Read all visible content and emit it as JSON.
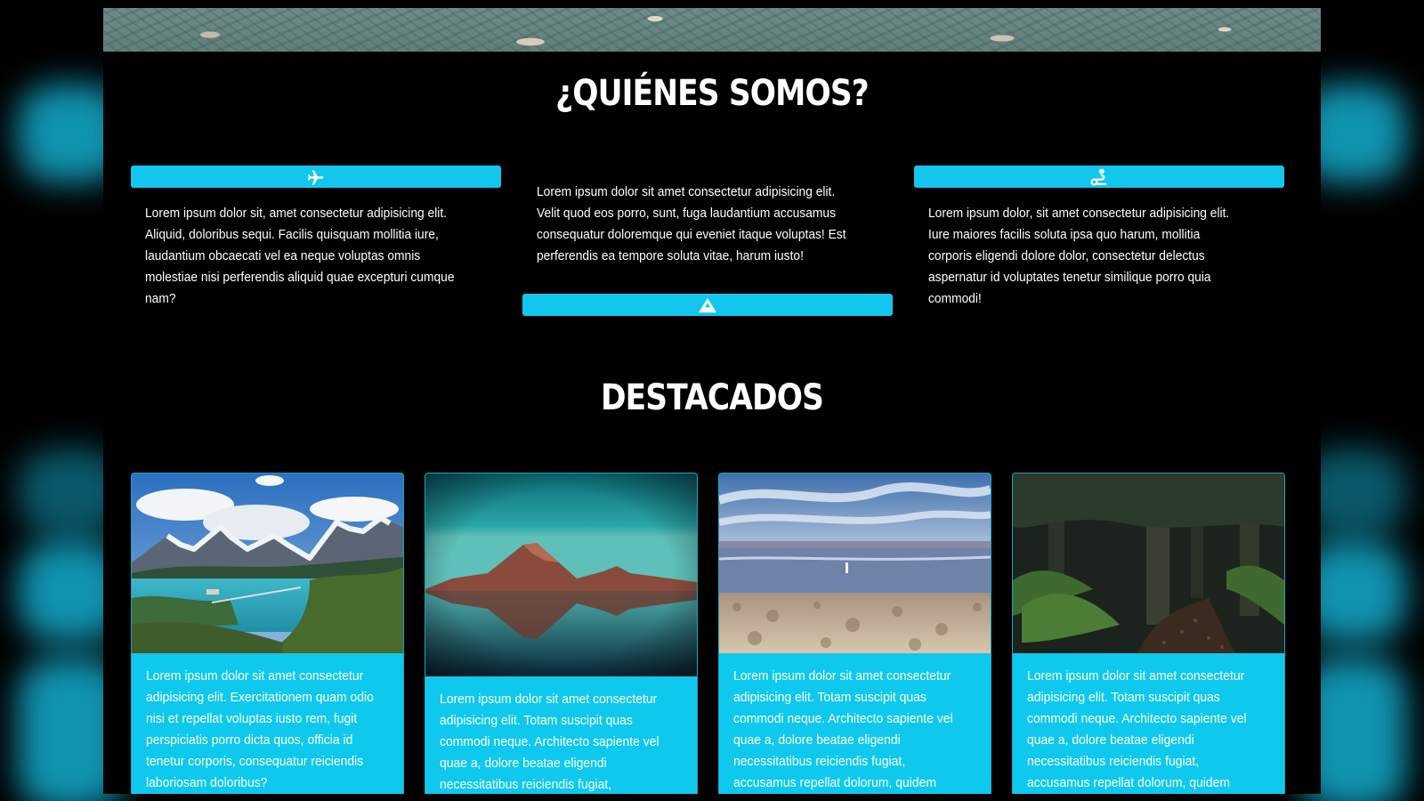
{
  "about": {
    "title": "¿QUIÉNES SOMOS?",
    "columns": [
      {
        "icon": "airplane-icon",
        "text": "Lorem ipsum dolor sit, amet consectetur adipisicing elit. Aliquid, doloribus sequi. Facilis quisquam mollitia iure, laudantium obcaecati vel ea neque voluptas omnis molestiae nisi perferendis aliquid quae excepturi cumque nam?"
      },
      {
        "icon": "mountain-icon",
        "text": "Lorem ipsum dolor sit amet consectetur adipisicing elit. Velit quod eos porro, sunt, fuga laudantium accusamus consequatur doloremque qui eveniet itaque voluptas! Est perferendis ea tempore soluta vitae, harum iusto!"
      },
      {
        "icon": "route-icon",
        "text": "Lorem ipsum dolor, sit amet consectetur adipisicing elit. Iure maiores facilis soluta ipsa quo harum, mollitia corporis eligendi dolore dolor, consectetur delectus aspernatur id voluptates tenetur similique porro quia commodi!"
      }
    ]
  },
  "featured": {
    "title": "DESTACADOS",
    "cards": [
      {
        "image": "lake-mountains-photo",
        "text": "Lorem ipsum dolor sit amet consectetur adipisicing elit. Exercitationem quam odio nisi et repellat voluptas iusto rem, fugit perspiciatis porro dicta quos, officia id tenetur corporis, consequatur reiciendis laboriosam doloribus?"
      },
      {
        "image": "volcano-reflection-photo",
        "text": "Lorem ipsum dolor sit amet consectetur adipisicing elit. Totam suscipit quas commodi neque. Architecto sapiente vel quae a, dolore beatae eligendi necessitatibus reiciendis fugiat, accusamus repellat dolorum, quidem"
      },
      {
        "image": "salt-flat-lagoon-photo",
        "text": "Lorem ipsum dolor sit amet consectetur adipisicing elit. Totam suscipit quas commodi neque. Architecto sapiente vel quae a, dolore beatae eligendi necessitatibus reiciendis fugiat, accusamus repellat dolorum, quidem ipsum porro?"
      },
      {
        "image": "forest-trail-photo",
        "text": "Lorem ipsum dolor sit amet consectetur adipisicing elit. Totam suscipit quas commodi neque. Architecto sapiente vel quae a, dolore beatae eligendi necessitatibus reiciendis fugiat, accusamus repellat dolorum, quidem ipsum porro?"
      }
    ]
  },
  "colors": {
    "accent": "#13c6ee",
    "background": "#000000",
    "text": "#ffffff"
  }
}
